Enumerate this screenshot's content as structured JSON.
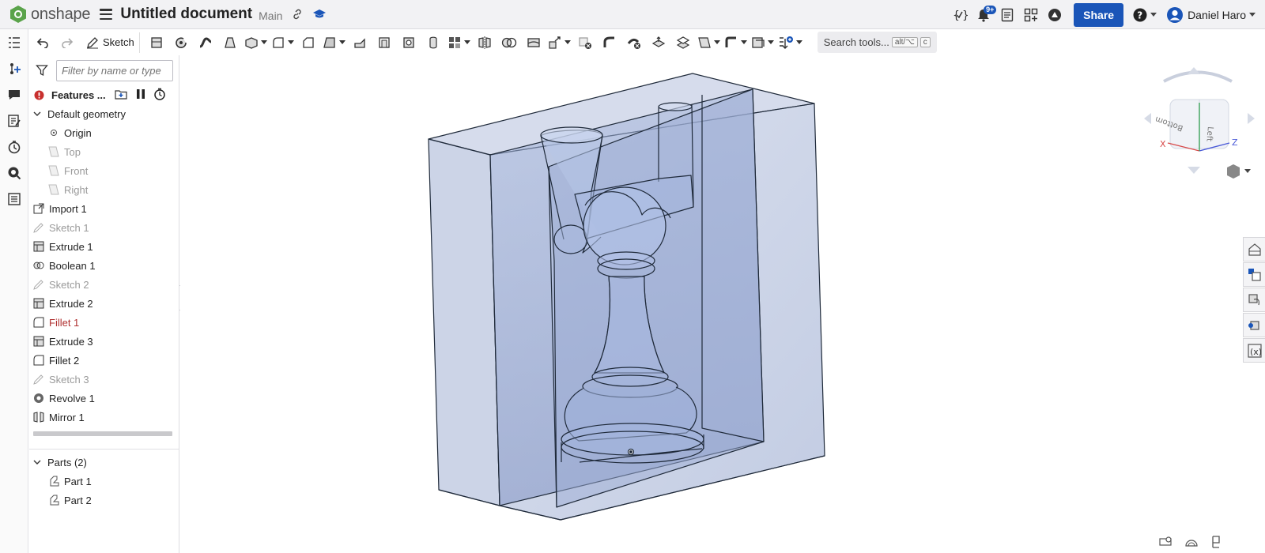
{
  "app": {
    "logo_text": "onshape"
  },
  "document": {
    "title": "Untitled document",
    "branch": "Main"
  },
  "header": {
    "notifications_badge": "9+",
    "share_label": "Share",
    "user_name": "Daniel Haro"
  },
  "toolbar": {
    "sketch_label": "Sketch",
    "search_label": "Search tools...",
    "search_shortcut_1": "alt/⌥",
    "search_shortcut_2": "c"
  },
  "panel": {
    "filter_placeholder": "Filter by name or type",
    "features_label": "Features ...",
    "default_geometry_label": "Default geometry",
    "items": [
      {
        "label": "Origin",
        "icon": "origin-icon",
        "state": "normal",
        "indent": true
      },
      {
        "label": "Top",
        "icon": "plane-icon",
        "state": "dim",
        "indent": true
      },
      {
        "label": "Front",
        "icon": "plane-icon",
        "state": "dim",
        "indent": true
      },
      {
        "label": "Right",
        "icon": "plane-icon",
        "state": "dim",
        "indent": true
      },
      {
        "label": "Import 1",
        "icon": "import-icon",
        "state": "normal"
      },
      {
        "label": "Sketch 1",
        "icon": "sketch-icon",
        "state": "dim"
      },
      {
        "label": "Extrude 1",
        "icon": "extrude-icon",
        "state": "normal"
      },
      {
        "label": "Boolean 1",
        "icon": "boolean-icon",
        "state": "normal"
      },
      {
        "label": "Sketch 2",
        "icon": "sketch-icon",
        "state": "dim"
      },
      {
        "label": "Extrude 2",
        "icon": "extrude-icon",
        "state": "normal"
      },
      {
        "label": "Fillet 1",
        "icon": "fillet-icon",
        "state": "err"
      },
      {
        "label": "Extrude 3",
        "icon": "extrude-icon",
        "state": "normal"
      },
      {
        "label": "Fillet 2",
        "icon": "fillet-icon",
        "state": "normal"
      },
      {
        "label": "Sketch 3",
        "icon": "sketch-icon",
        "state": "dim"
      },
      {
        "label": "Revolve 1",
        "icon": "revolve-icon",
        "state": "normal"
      },
      {
        "label": "Mirror 1",
        "icon": "mirror-icon",
        "state": "normal"
      }
    ],
    "parts_label": "Parts (2)",
    "parts": [
      {
        "label": "Part 1"
      },
      {
        "label": "Part 2"
      }
    ]
  },
  "viewcube": {
    "face_left": "Left",
    "face_bottom": "Bottom",
    "axis_x": "X",
    "axis_z": "Z"
  },
  "colors": {
    "accent": "#1a55b8",
    "error": "#b03030",
    "model_fill": "#9fb0d4",
    "model_edge": "#1f2a3a"
  }
}
